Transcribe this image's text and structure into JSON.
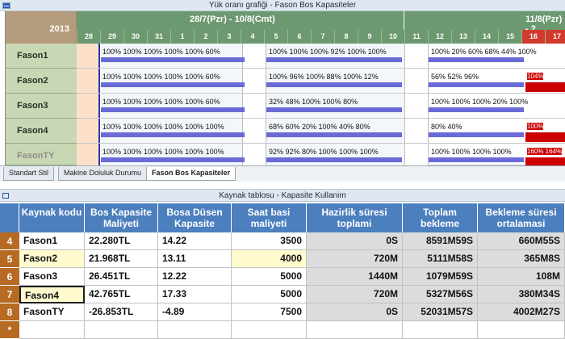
{
  "top_window": {
    "title": "Yük oranı grafiği - Fason Bos Kapasiteler",
    "year": "2013",
    "weeks": [
      {
        "label": "28/7(Pzr) - 10/8(Cmt)"
      },
      {
        "label": "11/8(Pzr) - 2"
      }
    ],
    "days": [
      "28",
      "29",
      "30",
      "31",
      "1",
      "2",
      "3",
      "4",
      "5",
      "6",
      "7",
      "8",
      "9",
      "10",
      "11",
      "12",
      "13",
      "14",
      "15",
      "16",
      "17"
    ],
    "red_days": [
      "16",
      "17"
    ],
    "resources": [
      "Fason1",
      "Fason2",
      "Fason3",
      "Fason4",
      "FasonTY"
    ],
    "rows": [
      {
        "w1": "100% 100% 100% 100% 100% 60%",
        "w2": "100% 100% 100% 92% 100% 100%",
        "w3": "100% 20% 60% 68% 44% 100%"
      },
      {
        "w1": "100% 100% 100% 100% 100% 60%",
        "w2": "100% 96% 100% 88% 100% 12%",
        "w3": "56% 52% 96%",
        "over": "104%"
      },
      {
        "w1": "100% 100% 100% 100% 100% 60%",
        "w2": "32% 48% 100% 100% 80%",
        "w3": "100% 100% 100% 20% 100%"
      },
      {
        "w1": "100% 100% 100% 100% 100% 100%",
        "w2": "68% 60% 20% 100% 40% 80%",
        "w3": "80% 40%",
        "over": "100%"
      },
      {
        "w1": "100% 100% 100% 100% 100% 100%",
        "w2": "92% 92% 80% 100% 100% 100%",
        "w3": "100% 100% 100% 100%",
        "over": "160% 164%"
      }
    ],
    "tabs": [
      "Standart Stil",
      "Makine Doluluk Durumu",
      "Fason Bos Kapasiteler"
    ]
  },
  "bottom_window": {
    "title": "Kaynak tablosu - Kapasite Kullanim",
    "headers": [
      "Kaynak kodu",
      "Bos Kapasite Maliyeti",
      "Bosa Düsen Kapasite",
      "Saat basi maliyeti",
      "Hazirlik süresi toplami",
      "Toplam bekleme",
      "Bekleme süresi ortalamasi"
    ],
    "rows": [
      {
        "num": "4",
        "kod": "Fason1",
        "maliyet": "22.280TL",
        "kapasite": "14.22",
        "saat": "3500",
        "hazirlik": "0S",
        "bekleme": "8591M59S",
        "ortalama": "660M55S"
      },
      {
        "num": "5",
        "kod": "Fason2",
        "maliyet": "21.968TL",
        "kapasite": "13.11",
        "saat": "4000",
        "hazirlik": "720M",
        "bekleme": "5111M58S",
        "ortalama": "365M8S"
      },
      {
        "num": "6",
        "kod": "Fason3",
        "maliyet": "26.451TL",
        "kapasite": "12.22",
        "saat": "5000",
        "hazirlik": "1440M",
        "bekleme": "1079M59S",
        "ortalama": "108M"
      },
      {
        "num": "7",
        "kod": "Fason4",
        "maliyet": "42.765TL",
        "kapasite": "17.33",
        "saat": "5000",
        "hazirlik": "720M",
        "bekleme": "5327M56S",
        "ortalama": "380M34S"
      },
      {
        "num": "8",
        "kod": "FasonTY",
        "maliyet": "-26.853TL",
        "kapasite": "-4.89",
        "saat": "7500",
        "hazirlik": "0S",
        "bekleme": "52031M57S",
        "ortalama": "4002M27S"
      }
    ],
    "new_row_marker": "*"
  }
}
